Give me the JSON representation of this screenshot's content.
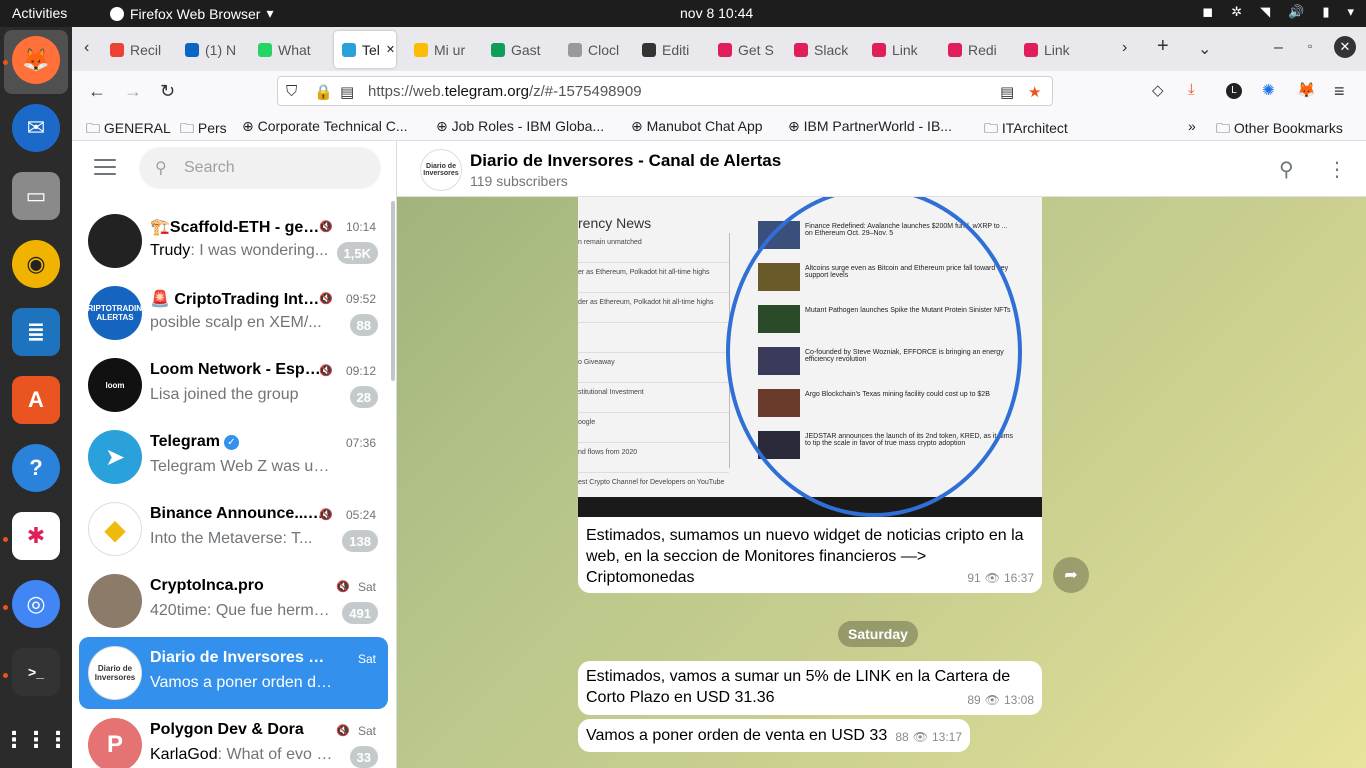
{
  "system": {
    "activities": "Activities",
    "app_name": "Firefox Web Browser",
    "clock": "nov 8  10:44"
  },
  "dock": {
    "apps": [
      "firefox-icon",
      "thunderbird-icon",
      "files-icon",
      "rhythmbox-icon",
      "writer-icon",
      "app-center-icon",
      "help-icon",
      "slack-icon",
      "chrome-icon",
      "terminal-icon",
      "show-apps-icon"
    ]
  },
  "tabs": [
    {
      "label": "Recil",
      "color": "#ea4335"
    },
    {
      "label": "(1) N",
      "color": "#0a66c2"
    },
    {
      "label": "What",
      "color": "#25d366"
    },
    {
      "label": "Tel",
      "color": "#2aa1da"
    },
    {
      "label": "Mi ur",
      "color": "#fbbc04"
    },
    {
      "label": "Gast",
      "color": "#0f9d58"
    },
    {
      "label": "Clocl",
      "color": "#999999"
    },
    {
      "label": "Editi",
      "color": "#333333"
    },
    {
      "label": "Get S",
      "color": "#e01e5a"
    },
    {
      "label": "Slack",
      "color": "#e01e5a"
    },
    {
      "label": "Link",
      "color": "#e01e5a"
    },
    {
      "label": "Redi",
      "color": "#e01e5a"
    },
    {
      "label": "Link",
      "color": "#e01e5a"
    }
  ],
  "address": {
    "url_prefix": "https://web.",
    "url_domain": "telegram.org",
    "url_suffix": "/z/#-1575498909"
  },
  "bookmarks": [
    "GENERAL",
    "Pers",
    "Corporate Technical C...",
    "Job Roles - IBM Globa...",
    "Manubot Chat App",
    "IBM PartnerWorld - IB...",
    "ITArchitect",
    "Other Bookmarks"
  ],
  "sidebar": {
    "search_placeholder": "Search",
    "chats": [
      {
        "name": "🏗️Scaffold-ETH - gen...",
        "time": "10:14",
        "msg_author": "Trudy",
        "msg": ": I was wondering...",
        "badge": "1,5K",
        "muted": true,
        "avatar_color": "#222222",
        "avatar_text": ""
      },
      {
        "name": "🚨 CriptoTrading Intel...",
        "time": "09:52",
        "msg_author": "",
        "msg": "posible scalp en XEM/...",
        "badge": "88",
        "muted": true,
        "avatar_color": "#1565c0",
        "avatar_text": "CRIPTOTRADING ALERTAS"
      },
      {
        "name": "Loom Network - Espa...",
        "time": "09:12",
        "msg_author": "",
        "msg": "Lisa joined the group",
        "badge": "28",
        "muted": true,
        "avatar_color": "#111111",
        "avatar_text": "loom"
      },
      {
        "name": "Telegram",
        "time": "07:36",
        "msg_author": "",
        "msg": "Telegram Web Z was updated...",
        "badge": "",
        "muted": false,
        "verified": true,
        "avatar_color": "#2aa1da",
        "avatar_text": "➤"
      },
      {
        "name": "Binance Announce...",
        "time": "05:24",
        "msg_author": "",
        "msg": "Into the Metaverse: T...",
        "badge": "138",
        "muted": true,
        "verified": true,
        "avatar_color": "#ffffff",
        "avatar_text": "◆"
      },
      {
        "name": "CryptoInca.pro",
        "time": "Sat",
        "msg_author": "",
        "msg": "420time: Que fue herma...",
        "badge": "491",
        "muted": true,
        "avatar_color": "#8d7b6a",
        "avatar_text": ""
      },
      {
        "name": "Diario de Inversores - C...",
        "time": "Sat",
        "msg_author": "",
        "msg": "Vamos a poner orden de vent...",
        "badge": "",
        "muted": false,
        "selected": true,
        "avatar_color": "#ffffff",
        "avatar_text": "Diario de Inversores"
      },
      {
        "name": "Polygon Dev & Dora",
        "time": "Sat",
        "msg_author": "KarlaGod",
        "msg": ": What of evo de...",
        "badge": "33",
        "muted": true,
        "avatar_color": "#e57373",
        "avatar_text": "P"
      }
    ]
  },
  "chat": {
    "title": "Diario de Inversores - Canal de Alertas",
    "subtitle": "119 subscribers",
    "avatar_text": "Diario de Inversores",
    "photo": {
      "heading": "rency News",
      "left_rows": [
        "n remain unmatched",
        "er as Ethereum, Polkadot hit all-time highs",
        "der as Ethereum, Polkadot hit all-time highs",
        "",
        "o Giveaway",
        "stitutional Investment",
        "oogle",
        "nd flows from 2020",
        "est Crypto Channel for Developers on YouTube"
      ],
      "news": [
        "Finance Redefined: Avalanche launches $200M fund, wXRP to ... on Ethereum Oct. 29–Nov. 5",
        "Altcoins surge even as Bitcoin and Ethereum price fall toward key support levels",
        "Mutant Pathogen launches Spike the Mutant Protein Sinister NFTs",
        "Co-founded by Steve Wozniak, EFFORCE is bringing an energy efficiency revolution",
        "Argo Blockchain's Texas mining facility could cost up to $2B",
        "JEDSTAR announces the launch of its 2nd token, KRED, as it aims to tip the scale in favor of true mass crypto adoption"
      ]
    },
    "messages": [
      {
        "text": "Estimados, sumamos un nuevo widget de noticias cripto en la web, en la seccion de Monitores financieros —> Criptomonedas",
        "views": "91",
        "time": "16:37"
      },
      {
        "text": "Estimados, vamos a sumar un 5% de LINK en la Cartera de Corto Plazo en USD 31.36",
        "views": "89",
        "time": "13:08"
      },
      {
        "text": "Vamos a poner orden de venta en USD 33",
        "views": "88",
        "time": "13:17"
      }
    ],
    "date_separator": "Saturday"
  }
}
